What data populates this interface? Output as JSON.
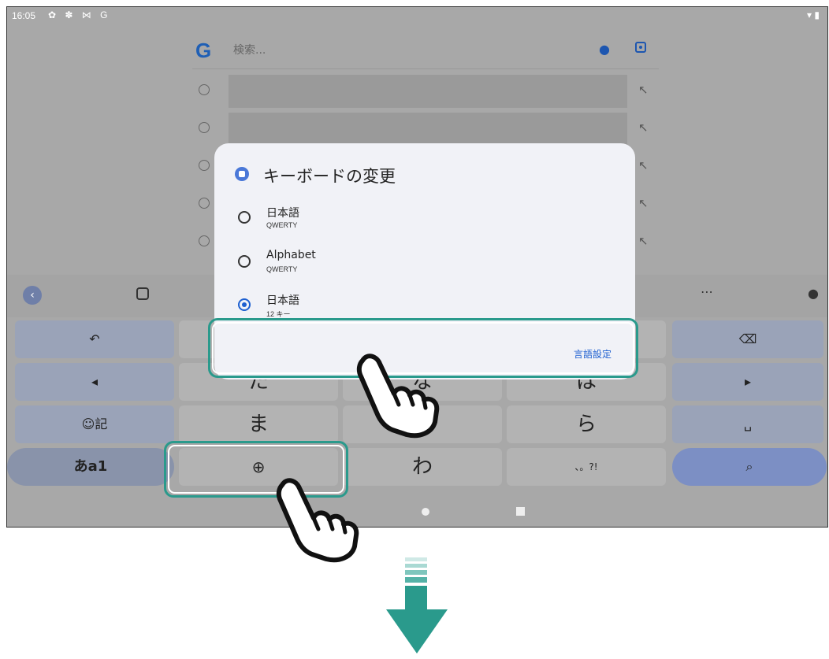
{
  "status": {
    "time": "16:05",
    "icons": "✿ ✽ ⋈ G",
    "right": "▾ ▮"
  },
  "search": {
    "logo": "G",
    "placeholder": "検索..."
  },
  "toolbar": {
    "back": "‹",
    "dots": "⋯",
    "mic": "🎙"
  },
  "keyboard": {
    "row1": {
      "left": "↶",
      "right": "⌫"
    },
    "row2": {
      "left": "◂",
      "c1": "た",
      "c2": "な",
      "c3": "は",
      "right": "▸"
    },
    "row3": {
      "left": "☺記",
      "c1": "ま",
      "c2": "や",
      "c3": "ら",
      "right": "␣"
    },
    "row4": {
      "mode": "あa1",
      "globe": "⊕",
      "c2": "わ",
      "c3": "、。?!",
      "search": "⌕"
    }
  },
  "dialog": {
    "title": "キーボードの変更",
    "options": [
      {
        "label": "日本語",
        "sub": "QWERTY",
        "selected": false
      },
      {
        "label": "Alphabet",
        "sub": "QWERTY",
        "selected": false
      },
      {
        "label": "日本語",
        "sub": "12 キー",
        "selected": true
      }
    ],
    "footer_link": "言語設定"
  },
  "colors": {
    "accent": "#2a9a8c",
    "link": "#1d5fd0"
  }
}
